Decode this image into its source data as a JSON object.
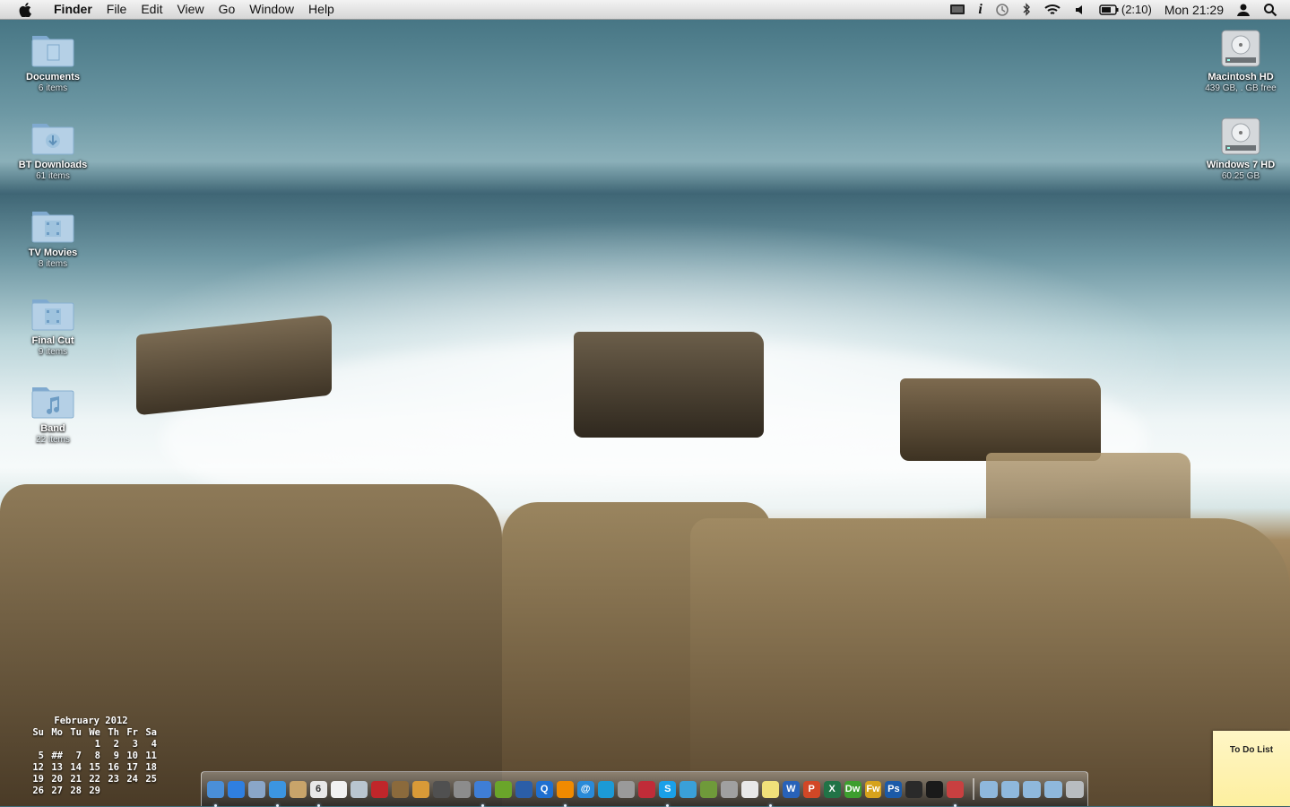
{
  "menubar": {
    "app_name": "Finder",
    "menus": [
      "File",
      "Edit",
      "View",
      "Go",
      "Window",
      "Help"
    ],
    "battery_time": "(2:10)",
    "clock": "Mon 21:29"
  },
  "desktop_left": [
    {
      "name": "Documents",
      "sub": "6 items",
      "icon": "documents-folder-icon"
    },
    {
      "name": "BT Downloads",
      "sub": "61 items",
      "icon": "downloads-folder-icon"
    },
    {
      "name": "TV Movies",
      "sub": "8 items",
      "icon": "movies-folder-icon"
    },
    {
      "name": "Final Cut",
      "sub": "9 items",
      "icon": "movies-folder-icon"
    },
    {
      "name": "Band",
      "sub": "22 items",
      "icon": "music-folder-icon"
    }
  ],
  "desktop_right": [
    {
      "name": "Macintosh HD",
      "sub": "439 GB, . GB free",
      "icon": "hard-drive-icon"
    },
    {
      "name": "Windows 7 HD",
      "sub": "60.25 GB",
      "icon": "hard-drive-icon"
    }
  ],
  "calendar": {
    "title": "February 2012",
    "days": [
      "Su",
      "Mo",
      "Tu",
      "We",
      "Th",
      "Fr",
      "Sa"
    ],
    "weeks": [
      [
        "",
        "",
        "",
        "1",
        "2",
        "3",
        "4"
      ],
      [
        "5",
        "##",
        "7",
        "8",
        "9",
        "10",
        "11"
      ],
      [
        "12",
        "13",
        "14",
        "15",
        "16",
        "17",
        "18"
      ],
      [
        "19",
        "20",
        "21",
        "22",
        "23",
        "24",
        "25"
      ],
      [
        "26",
        "27",
        "28",
        "29",
        "",
        "",
        ""
      ]
    ]
  },
  "sticky": {
    "title": "To Do List"
  },
  "dock": {
    "apps": [
      {
        "icon": "finder-icon",
        "color": "#4a8fd8",
        "label": "",
        "running": true
      },
      {
        "icon": "app-store-icon",
        "color": "#2f7fe0",
        "label": "",
        "running": false
      },
      {
        "icon": "preview-icon",
        "color": "#8aa6c8",
        "label": "",
        "running": false
      },
      {
        "icon": "safari-icon",
        "color": "#3c95e0",
        "label": "",
        "running": true
      },
      {
        "icon": "address-book-icon",
        "color": "#c8a46a",
        "label": "",
        "running": false
      },
      {
        "icon": "ical-icon",
        "color": "#e8e8e8",
        "label": "6",
        "running": true
      },
      {
        "icon": "textedit-icon",
        "color": "#f2f2f2",
        "label": "",
        "running": false
      },
      {
        "icon": "mail-stamp-icon",
        "color": "#b9c5cf",
        "label": "",
        "running": false
      },
      {
        "icon": "photo-booth-icon",
        "color": "#c0262a",
        "label": "",
        "running": false
      },
      {
        "icon": "iphoto-icon",
        "color": "#8b6a3c",
        "label": "",
        "running": false
      },
      {
        "icon": "garageband-icon",
        "color": "#d99a37",
        "label": "",
        "running": false
      },
      {
        "icon": "dvd-player-icon",
        "color": "#505050",
        "label": "",
        "running": false
      },
      {
        "icon": "imovie-icon",
        "color": "#8c8c8c",
        "label": "",
        "running": false
      },
      {
        "icon": "itunes-icon",
        "color": "#3f7ed6",
        "label": "",
        "running": true
      },
      {
        "icon": "spotify-icon",
        "color": "#6aa52a",
        "label": "",
        "running": false
      },
      {
        "icon": "network-icon",
        "color": "#2b5ea8",
        "label": "",
        "running": false
      },
      {
        "icon": "quicktime-icon",
        "color": "#1f6fd0",
        "label": "Q",
        "running": false
      },
      {
        "icon": "vlc-icon",
        "color": "#f08a00",
        "label": "",
        "running": true
      },
      {
        "icon": "at-icon",
        "color": "#2a8ad8",
        "label": "@",
        "running": false
      },
      {
        "icon": "snow-icon",
        "color": "#1c9ad6",
        "label": "",
        "running": false
      },
      {
        "icon": "screenshot-icon",
        "color": "#9a9a9a",
        "label": "",
        "running": false
      },
      {
        "icon": "chess-icon",
        "color": "#c02c38",
        "label": "",
        "running": false
      },
      {
        "icon": "skype-icon",
        "color": "#1aa0e8",
        "label": "S",
        "running": true
      },
      {
        "icon": "dashboard-icon",
        "color": "#3aa0d8",
        "label": "",
        "running": false
      },
      {
        "icon": "plant-icon",
        "color": "#6f9a3a",
        "label": "",
        "running": false
      },
      {
        "icon": "archive-icon",
        "color": "#a0a0a0",
        "label": "",
        "running": false
      },
      {
        "icon": "script-icon",
        "color": "#e8e8e8",
        "label": "",
        "running": false
      },
      {
        "icon": "stickies-icon",
        "color": "#f1e07a",
        "label": "",
        "running": true
      },
      {
        "icon": "word-icon",
        "color": "#2862b9",
        "label": "W",
        "running": false
      },
      {
        "icon": "powerpoint-icon",
        "color": "#d24726",
        "label": "P",
        "running": false
      },
      {
        "icon": "excel-icon",
        "color": "#217346",
        "label": "X",
        "running": false
      },
      {
        "icon": "dreamweaver-icon",
        "color": "#3d9e2e",
        "label": "Dw",
        "running": false
      },
      {
        "icon": "fireworks-icon",
        "color": "#d6a21c",
        "label": "Fw",
        "running": false
      },
      {
        "icon": "photoshop-icon",
        "color": "#1b5aa8",
        "label": "Ps",
        "running": false
      },
      {
        "icon": "activity-monitor-icon",
        "color": "#2a2a2a",
        "label": "",
        "running": false
      },
      {
        "icon": "terminal-icon",
        "color": "#1a1a1a",
        "label": "",
        "running": false
      },
      {
        "icon": "flag-icon",
        "color": "#c84040",
        "label": "",
        "running": true
      }
    ],
    "stacks": [
      {
        "icon": "stack-folder-icon",
        "color": "#8fb8dc"
      },
      {
        "icon": "stack-folder-icon",
        "color": "#8fb8dc"
      },
      {
        "icon": "stack-folder-icon",
        "color": "#8fb8dc"
      },
      {
        "icon": "stack-folder-icon",
        "color": "#8fb8dc"
      },
      {
        "icon": "trash-icon",
        "color": "#b8bcc0"
      }
    ]
  }
}
